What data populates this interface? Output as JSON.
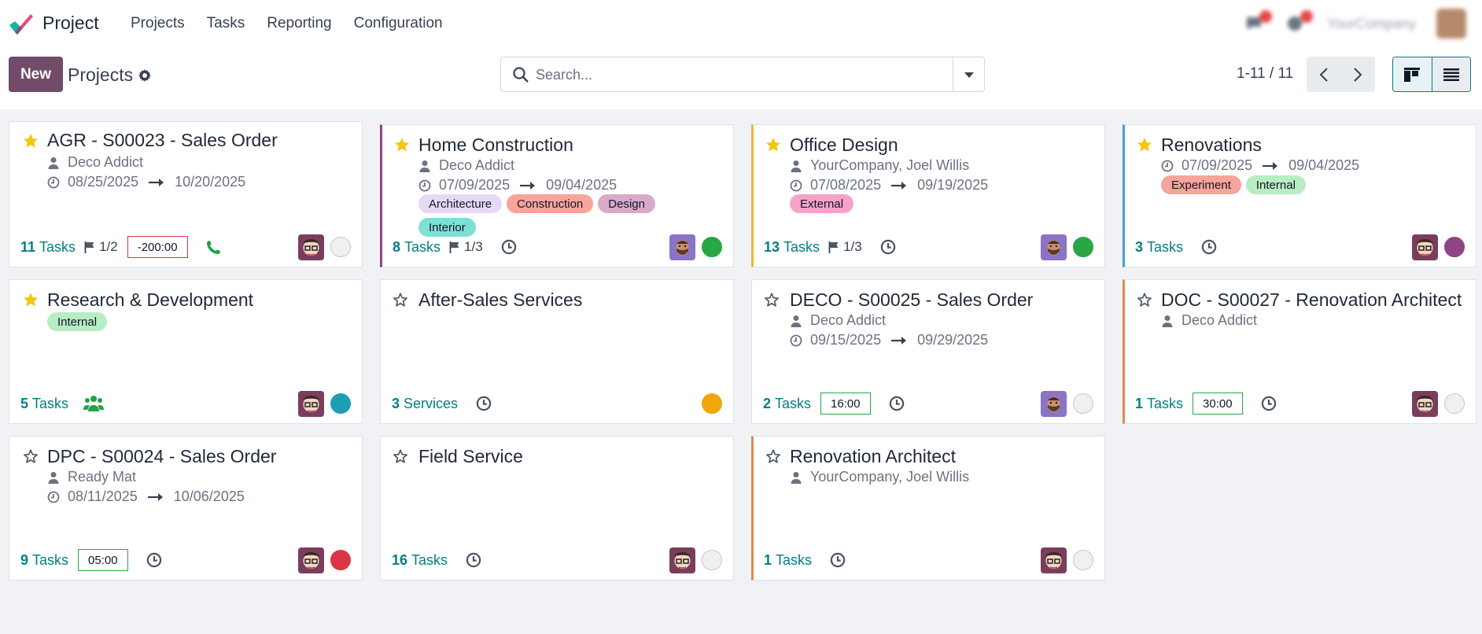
{
  "app": {
    "name": "Project"
  },
  "menu": [
    "Projects",
    "Tasks",
    "Reporting",
    "Configuration"
  ],
  "systray": {
    "company": "YourCompany"
  },
  "control": {
    "new_label": "New",
    "breadcrumb": "Projects",
    "search_placeholder": "Search...",
    "pager": "1-11 / 11"
  },
  "colors": {
    "brand": "#714b67",
    "accent": "#017e84"
  },
  "cards": [
    {
      "name": "AGR - S00023 - Sales Order",
      "favorite": true,
      "customer": "Deco Addict",
      "date_start": "08/25/2025",
      "date_end": "10/20/2025",
      "tags": [],
      "count": "11",
      "count_label": "Tasks",
      "milestone": "1/2",
      "hours": "-200:00",
      "status": "grey"
    },
    {
      "name": "Home Construction",
      "favorite": true,
      "customer": "Deco Addict",
      "date_start": "07/09/2025",
      "date_end": "09/04/2025",
      "tags": [
        "Architecture",
        "Construction",
        "Design",
        "Interior"
      ],
      "count": "8",
      "count_label": "Tasks",
      "milestone": "1/3",
      "status": "green"
    },
    {
      "name": "Office Design",
      "favorite": true,
      "customer": "YourCompany, Joel Willis",
      "date_start": "07/08/2025",
      "date_end": "09/19/2025",
      "tags": [
        "External"
      ],
      "count": "13",
      "count_label": "Tasks",
      "milestone": "1/3",
      "status": "green"
    },
    {
      "name": "Renovations",
      "favorite": true,
      "date_start": "07/09/2025",
      "date_end": "09/04/2025",
      "tags": [
        "Experiment",
        "Internal"
      ],
      "count": "3",
      "count_label": "Tasks",
      "status": "purple"
    },
    {
      "name": "Research & Development",
      "favorite": true,
      "tags": [
        "Internal"
      ],
      "count": "5",
      "count_label": "Tasks",
      "status": "teal"
    },
    {
      "name": "After-Sales Services",
      "favorite": false,
      "tags": [],
      "count": "3",
      "count_label": "Services",
      "status": "orange"
    },
    {
      "name": "DECO - S00025 - Sales Order",
      "favorite": false,
      "customer": "Deco Addict",
      "date_start": "09/15/2025",
      "date_end": "09/29/2025",
      "tags": [],
      "count": "2",
      "count_label": "Tasks",
      "hours": "16:00",
      "status": "grey"
    },
    {
      "name": "DOC - S00027 - Renovation Architect",
      "favorite": false,
      "customer": "Deco Addict",
      "tags": [],
      "count": "1",
      "count_label": "Tasks",
      "hours": "30:00",
      "status": "grey"
    },
    {
      "name": "DPC - S00024 - Sales Order",
      "favorite": false,
      "customer": "Ready Mat",
      "date_start": "08/11/2025",
      "date_end": "10/06/2025",
      "tags": [],
      "count": "9",
      "count_label": "Tasks",
      "hours": "05:00",
      "status": "red"
    },
    {
      "name": "Field Service",
      "favorite": false,
      "tags": [],
      "count": "16",
      "count_label": "Tasks",
      "status": "grey"
    },
    {
      "name": "Renovation Architect",
      "favorite": false,
      "customer": "YourCompany, Joel Willis",
      "tags": [],
      "count": "1",
      "count_label": "Tasks",
      "status": "grey"
    }
  ],
  "tag_colors": {
    "Architecture": "#e7d9f6",
    "Construction": "#f7a49b",
    "Design": "#d9a9c9",
    "Interior": "#7ee0d4",
    "External": "#f7a2c9",
    "Experiment": "#f7a49b",
    "Internal": "#b8ecc2"
  },
  "status_colors": {
    "grey": "#eef0f2",
    "green": "#28a745",
    "purple": "#8e4585",
    "teal": "#1c9fb3",
    "orange": "#f0a60a",
    "red": "#dc3545"
  }
}
